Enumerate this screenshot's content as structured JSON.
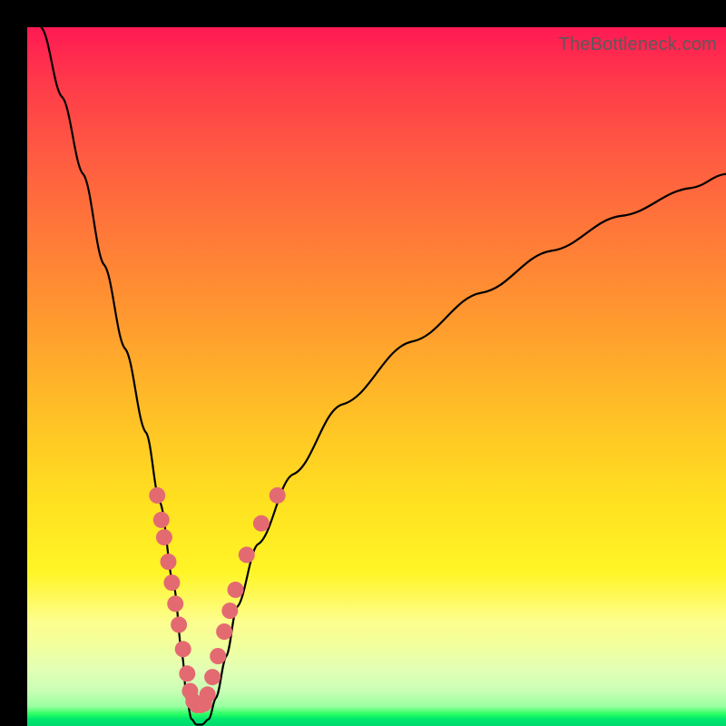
{
  "watermark": "TheBottleneck.com",
  "chart_data": {
    "type": "line",
    "title": "",
    "xlabel": "",
    "ylabel": "",
    "xlim": [
      0,
      100
    ],
    "ylim": [
      0,
      100
    ],
    "note": "Bottleneck V-curve diagram. x = relative component balance (arbitrary units), y = bottleneck severity (0 at bottom = no bottleneck, 100 at top = severe). Values estimated from plot pixels; axes are unlabeled in source.",
    "series": [
      {
        "name": "bottleneck-curve",
        "x": [
          2,
          5,
          8,
          11,
          14,
          17,
          19,
          21,
          22.2,
          22.8,
          23.5,
          24.2,
          25,
          26,
          27,
          28.5,
          30,
          33,
          38,
          45,
          55,
          65,
          75,
          85,
          95,
          100
        ],
        "y": [
          100,
          90,
          79,
          66,
          54,
          42,
          32,
          20,
          10,
          4,
          1,
          0.2,
          0.2,
          1,
          4,
          10,
          17,
          26,
          36,
          46,
          55,
          62,
          68,
          73,
          77,
          79
        ]
      }
    ],
    "dots": {
      "name": "sample-points",
      "note": "Salmon dots marking observed points along the curve in the pale-yellow / light-green band (roughly y between 3 and 33).",
      "points": [
        {
          "x": 18.6,
          "y": 33
        },
        {
          "x": 19.2,
          "y": 29.5
        },
        {
          "x": 19.6,
          "y": 27
        },
        {
          "x": 20.2,
          "y": 23.5
        },
        {
          "x": 20.7,
          "y": 20.5
        },
        {
          "x": 21.2,
          "y": 17.5
        },
        {
          "x": 21.7,
          "y": 14.5
        },
        {
          "x": 22.3,
          "y": 11
        },
        {
          "x": 22.9,
          "y": 7.5
        },
        {
          "x": 23.3,
          "y": 5
        },
        {
          "x": 23.8,
          "y": 3.5
        },
        {
          "x": 24.3,
          "y": 3
        },
        {
          "x": 24.8,
          "y": 3
        },
        {
          "x": 25.3,
          "y": 3.2
        },
        {
          "x": 25.8,
          "y": 4.5
        },
        {
          "x": 26.5,
          "y": 7
        },
        {
          "x": 27.3,
          "y": 10
        },
        {
          "x": 28.2,
          "y": 13.5
        },
        {
          "x": 29.0,
          "y": 16.5
        },
        {
          "x": 29.8,
          "y": 19.5
        },
        {
          "x": 31.4,
          "y": 24.5
        },
        {
          "x": 33.5,
          "y": 29
        },
        {
          "x": 35.8,
          "y": 33
        }
      ]
    },
    "gradient_stops": [
      {
        "y": 100,
        "color": "#ff1a53"
      },
      {
        "y": 70,
        "color": "#ff7a38"
      },
      {
        "y": 40,
        "color": "#ffd020"
      },
      {
        "y": 18,
        "color": "#fff85e"
      },
      {
        "y": 7,
        "color": "#d8ffb0"
      },
      {
        "y": 1,
        "color": "#20e868"
      }
    ]
  }
}
